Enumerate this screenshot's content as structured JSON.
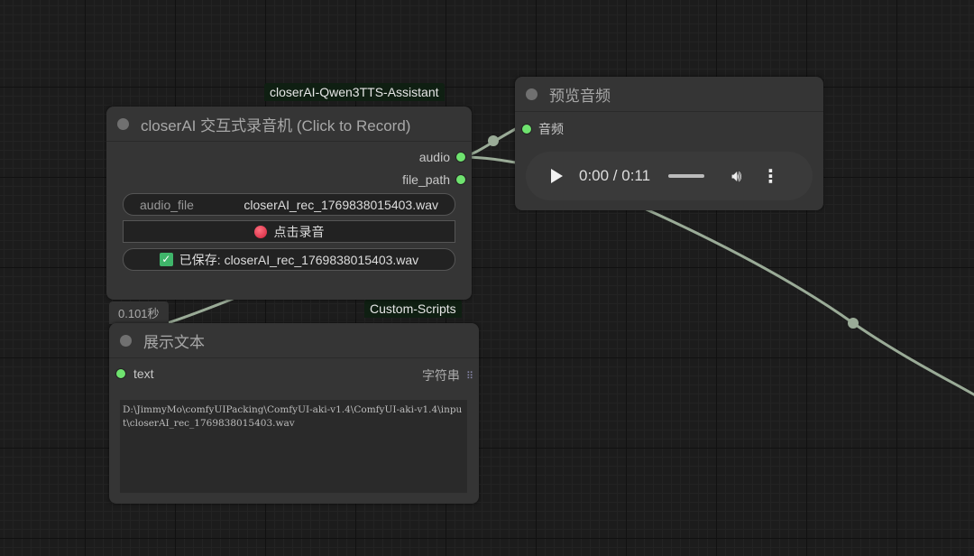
{
  "groups": {
    "top": "closerAI-Qwen3TTS-Assistant",
    "bottom": "Custom-Scripts"
  },
  "recorder": {
    "title": "closerAI 交互式录音机 (Click to Record)",
    "outputs": [
      "audio",
      "file_path"
    ],
    "audio_file_label": "audio_file",
    "audio_file_value": "closerAI_rec_1769838015403.wav",
    "record_button": "点击录音",
    "saved_status": "已保存: closerAI_rec_1769838015403.wav"
  },
  "timer": "0.101秒",
  "preview": {
    "title": "预览音频",
    "input": "音频",
    "time": "0:00 / 0:11"
  },
  "show_text": {
    "title": "展示文本",
    "input": "text",
    "type": "字符串",
    "content": "D:\\JimmyMo\\comfyUIPacking\\ComfyUI-aki-v1.4\\ComfyUI-aki-v1.4\\input\\closerAI_rec_1769838015403.wav"
  },
  "colors": {
    "link": "#9aab97",
    "socket": "#6fe36f",
    "record": "#e0334a"
  }
}
